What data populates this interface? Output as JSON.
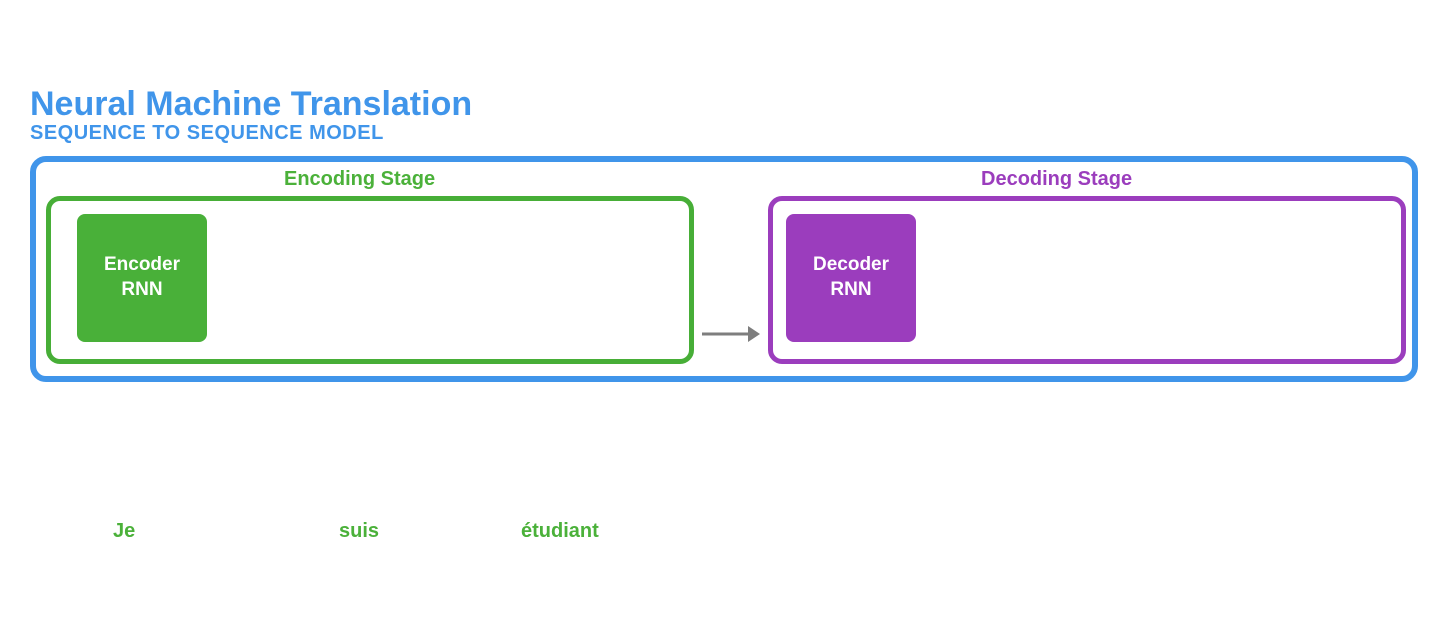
{
  "title": "Neural Machine Translation",
  "subtitle": "SEQUENCE TO SEQUENCE MODEL",
  "stages": {
    "encoding": {
      "label": "Encoding Stage",
      "block_label": "Encoder\nRNN"
    },
    "decoding": {
      "label": "Decoding Stage",
      "block_label": "Decoder\nRNN"
    }
  },
  "input_tokens": [
    "Je",
    "suis",
    "étudiant"
  ],
  "colors": {
    "blue": "#4095EA",
    "green": "#4BB13A",
    "green_fill": "#49B039",
    "green_border": "#47AE37",
    "purple": "#9B3DBD",
    "arrow": "#7E7E7E"
  }
}
